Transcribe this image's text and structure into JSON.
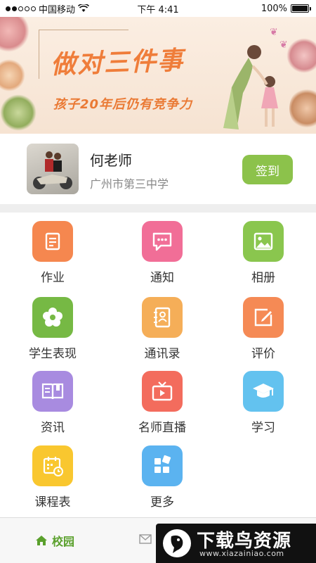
{
  "status_bar": {
    "carrier": "中国移动",
    "time": "下午 4:41",
    "battery": "100%",
    "battery_level": 1.0
  },
  "banner": {
    "title": "做对三件事",
    "subtitle": "孩子20年后仍有竞争力"
  },
  "profile": {
    "name": "何老师",
    "school": "广州市第三中学",
    "sign_in_label": "签到"
  },
  "menu": {
    "items": [
      {
        "label": "作业",
        "icon": "homework-book-icon",
        "color": "#f5874f"
      },
      {
        "label": "通知",
        "icon": "notice-chat-icon",
        "color": "#f16e97"
      },
      {
        "label": "相册",
        "icon": "photo-album-icon",
        "color": "#8ac64e"
      },
      {
        "label": "学生表现",
        "icon": "flower-icon",
        "color": "#76b944"
      },
      {
        "label": "通讯录",
        "icon": "contacts-icon",
        "color": "#f5ae58"
      },
      {
        "label": "评价",
        "icon": "edit-review-icon",
        "color": "#f58a55"
      },
      {
        "label": "资讯",
        "icon": "news-book-icon",
        "color": "#a88be0"
      },
      {
        "label": "名师直播",
        "icon": "live-tv-icon",
        "color": "#f36c5d"
      },
      {
        "label": "学习",
        "icon": "graduation-cap-icon",
        "color": "#63c2ef"
      },
      {
        "label": "课程表",
        "icon": "calendar-clock-icon",
        "color": "#f9c72f"
      },
      {
        "label": "更多",
        "icon": "more-blocks-icon",
        "color": "#5bb3f0"
      }
    ]
  },
  "tabbar": {
    "home_label": "校园"
  },
  "watermark": {
    "title": "下载鸟资源",
    "url": "www.xiazainiao.com"
  }
}
